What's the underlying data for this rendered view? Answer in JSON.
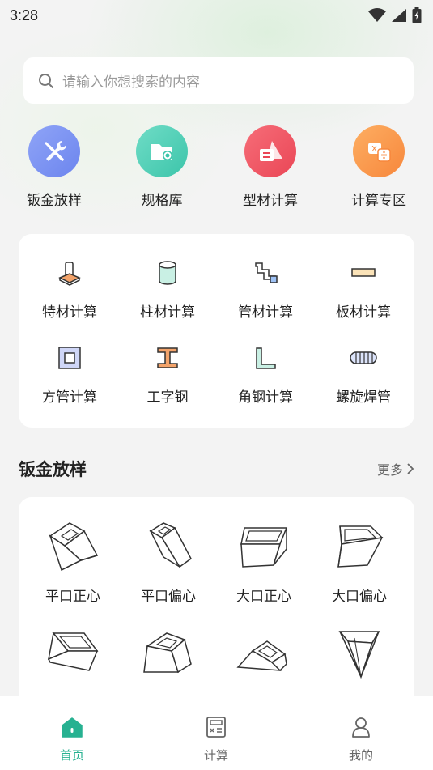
{
  "status": {
    "time": "3:28"
  },
  "search": {
    "placeholder": "请输入你想搜索的内容"
  },
  "quick_entries": [
    {
      "label": "钣金放样",
      "icon": "tools-icon",
      "color": "#7d95f3"
    },
    {
      "label": "规格库",
      "icon": "folder-settings-icon",
      "color": "#4fd0b7"
    },
    {
      "label": "型材计算",
      "icon": "shapes-icon",
      "color": "#f15a66"
    },
    {
      "label": "计算专区",
      "icon": "formula-icon",
      "color": "#fb9a4a"
    }
  ],
  "calc_grid": [
    {
      "label": "特材计算",
      "icon": "special-material-icon"
    },
    {
      "label": "柱材计算",
      "icon": "cylinder-icon"
    },
    {
      "label": "管材计算",
      "icon": "pipe-icon"
    },
    {
      "label": "板材计算",
      "icon": "plate-icon"
    },
    {
      "label": "方管计算",
      "icon": "square-tube-icon"
    },
    {
      "label": "工字钢",
      "icon": "i-beam-icon"
    },
    {
      "label": "角钢计算",
      "icon": "angle-steel-icon"
    },
    {
      "label": "螺旋焊管",
      "icon": "spiral-pipe-icon"
    }
  ],
  "sheet_section": {
    "title": "钣金放样",
    "more_label": "更多",
    "items": [
      {
        "label": "平口正心",
        "icon": "flat-center-icon"
      },
      {
        "label": "平口偏心",
        "icon": "flat-eccentric-icon"
      },
      {
        "label": "大口正心",
        "icon": "wide-center-icon"
      },
      {
        "label": "大口偏心",
        "icon": "wide-eccentric-icon"
      },
      {
        "label": "",
        "icon": "frustum-icon"
      },
      {
        "label": "",
        "icon": "pentagon-frustum-icon"
      },
      {
        "label": "",
        "icon": "low-frustum-icon"
      },
      {
        "label": "",
        "icon": "pyramid-icon"
      }
    ]
  },
  "tabs": [
    {
      "label": "首页",
      "icon": "home-icon",
      "active": true
    },
    {
      "label": "计算",
      "icon": "calculator-icon",
      "active": false
    },
    {
      "label": "我的",
      "icon": "user-icon",
      "active": false
    }
  ],
  "colors": {
    "accent": "#27b191",
    "background": "#f3f3f3"
  }
}
